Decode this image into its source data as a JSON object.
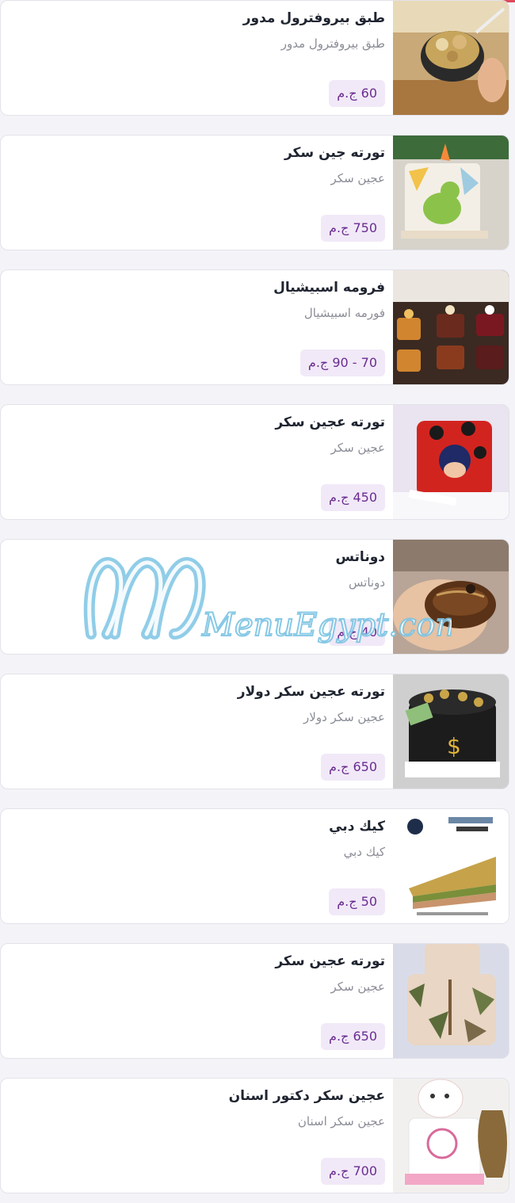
{
  "items": [
    {
      "name": "طبق بيروفترول مدور",
      "description": "طبق بيروفترول مدور",
      "price": "60 ج.م",
      "image": "profiterole-bowl-photo"
    },
    {
      "name": "تورته جين سكر",
      "description": "عجين سكر",
      "price": "750 ج.م",
      "image": "dinosaur-cake-photo"
    },
    {
      "name": "فرومه اسبيشيال",
      "description": "فورمه اسبيشيال",
      "price": "70 - 90 ج.م",
      "image": "mini-cakes-photo"
    },
    {
      "name": "تورته عجين سكر",
      "description": "عجين سكر",
      "price": "450 ج.م",
      "image": "ladybug-cake-photo"
    },
    {
      "name": "دوناتس",
      "description": "دوناتس",
      "price": "40 ج.م",
      "image": "donut-photo"
    },
    {
      "name": "تورته عجين سكر دولار",
      "description": "عجين سكر دولار",
      "price": "650 ج.م",
      "image": "dollar-cake-photo"
    },
    {
      "name": "كيك دبي",
      "description": "كيك دبي",
      "price": "50 ج.م",
      "image": "dubai-cake-photo"
    },
    {
      "name": "تورته عجين سكر",
      "description": "عجين سكر",
      "price": "650 ج.م",
      "image": "military-cake-photo"
    },
    {
      "name": "عجين سكر دكتور اسنان",
      "description": "عجين سكر اسنان",
      "price": "700 ج.م",
      "image": "dentist-cake-photo"
    }
  ],
  "watermark": "MenuEgypt.com",
  "colors": {
    "price_bg": "#f1e9f7",
    "price_text": "#6a2c91",
    "watermark": "#7cc4e4"
  }
}
